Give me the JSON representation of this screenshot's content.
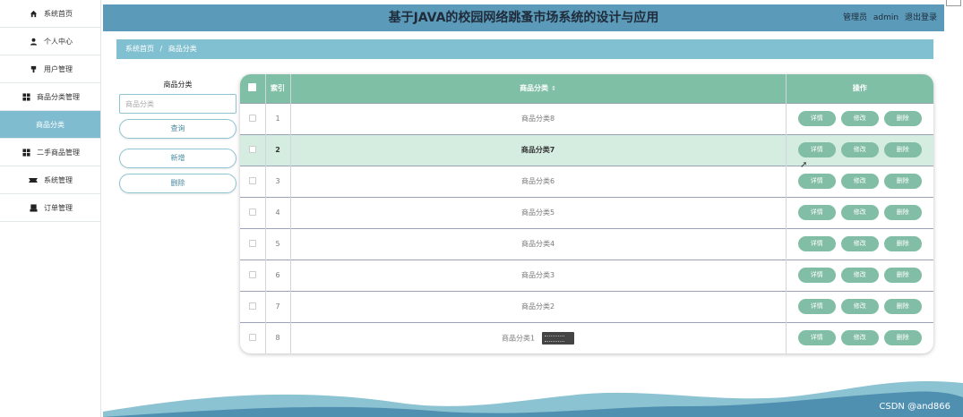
{
  "sidebar": {
    "items": [
      {
        "label": "系统首页",
        "icon": "home-icon"
      },
      {
        "label": "个人中心",
        "icon": "user-icon"
      },
      {
        "label": "用户管理",
        "icon": "user-manage-icon"
      },
      {
        "label": "商品分类管理",
        "icon": "grid-icon"
      },
      {
        "label": "商品分类",
        "icon": "",
        "active": true
      },
      {
        "label": "二手商品管理",
        "icon": "grid-icon"
      },
      {
        "label": "系统管理",
        "icon": "system-icon"
      },
      {
        "label": "订单管理",
        "icon": "order-icon"
      }
    ]
  },
  "header": {
    "title": "基于JAVA的校园网络跳蚤市场系统的设计与应用",
    "role": "管理员",
    "username": "admin",
    "logout": "退出登录"
  },
  "breadcrumb": {
    "home": "系统首页",
    "separator": "/",
    "current": "商品分类"
  },
  "search": {
    "label": "商品分类",
    "placeholder": "商品分类",
    "query_button": "查询",
    "add_button": "新增",
    "delete_button": "删除"
  },
  "table": {
    "headers": {
      "index": "索引",
      "category": "商品分类",
      "actions": "操作"
    },
    "action_labels": {
      "detail": "详情",
      "edit": "修改",
      "delete": "删除"
    },
    "rows": [
      {
        "index": "1",
        "category": "商品分类8"
      },
      {
        "index": "2",
        "category": "商品分类7",
        "selected": true
      },
      {
        "index": "3",
        "category": "商品分类6"
      },
      {
        "index": "4",
        "category": "商品分类5"
      },
      {
        "index": "5",
        "category": "商品分类4"
      },
      {
        "index": "6",
        "category": "商品分类3"
      },
      {
        "index": "7",
        "category": "商品分类2"
      },
      {
        "index": "8",
        "category": "商品分类1"
      }
    ]
  },
  "watermark": "CSDN @and866",
  "colors": {
    "header_bg": "#5b9ab8",
    "breadcrumb_bg": "#80c0d0",
    "table_header_bg": "#7fbfa6",
    "action_button": "#82bea5",
    "selected_row": "#d5ece0"
  }
}
